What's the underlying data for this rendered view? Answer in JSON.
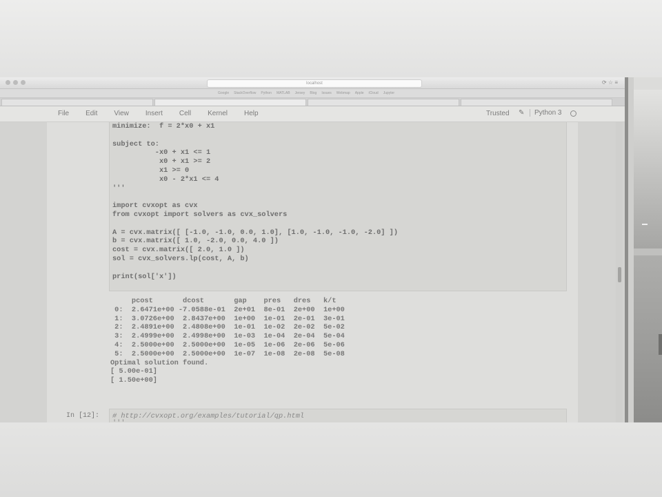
{
  "browser": {
    "url": "localhost",
    "bookmarks": [
      "Google",
      "StackOverflow",
      "Python",
      "MATLAB",
      "Jersey",
      "Blog",
      "Issues",
      "Webmap",
      "Apple",
      "iCloud",
      "Jupyter"
    ],
    "tabs": [
      "",
      "",
      "",
      ""
    ]
  },
  "menu": {
    "items": [
      "File",
      "Edit",
      "View",
      "Insert",
      "Cell",
      "Kernel",
      "Help"
    ],
    "trusted": "Trusted",
    "kernel": "Python 3"
  },
  "cell1": {
    "code": "minimize:  f = 2*x0 + x1\n\nsubject to:\n          -x0 + x1 <= 1\n           x0 + x1 >= 2\n           x1 >= 0\n           x0 - 2*x1 <= 4\n'''\n\nimport cvxopt as cvx\nfrom cvxopt import solvers as cvx_solvers\n\nA = cvx.matrix([ [-1.0, -1.0, 0.0, 1.0], [1.0, -1.0, -1.0, -2.0] ])\nb = cvx.matrix([ 1.0, -2.0, 0.0, 4.0 ])\ncost = cvx.matrix([ 2.0, 1.0 ])\nsol = cvx_solvers.lp(cost, A, b)\n\nprint(sol['x'])",
    "output": "     pcost       dcost       gap    pres   dres   k/t\n 0:  2.6471e+00 -7.0588e-01  2e+01  8e-01  2e+00  1e+00\n 1:  3.0726e+00  2.8437e+00  1e+00  1e-01  2e-01  3e-01\n 2:  2.4891e+00  2.4808e+00  1e-01  1e-02  2e-02  5e-02\n 3:  2.4999e+00  2.4998e+00  1e-03  1e-04  2e-04  5e-04\n 4:  2.5000e+00  2.5000e+00  1e-05  1e-06  2e-06  5e-06\n 5:  2.5000e+00  2.5000e+00  1e-07  1e-08  2e-08  5e-08\nOptimal solution found.\n[ 5.00e-01]\n[ 1.50e+00]"
  },
  "cell2": {
    "prompt": "In [12]:",
    "comment": "# http://cvxopt.org/examples/tutorial/qp.html",
    "next": "'''"
  }
}
